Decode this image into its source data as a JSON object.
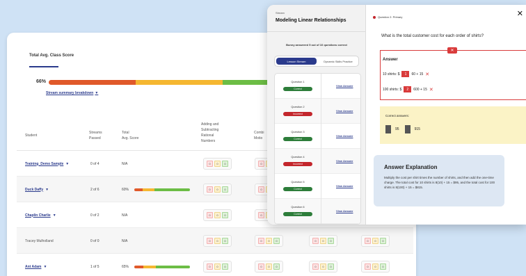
{
  "dashboard": {
    "total_avg_label": "Total Avg. Class Score",
    "total_avg_pct": "66%",
    "breakdown_link": "Stream summary breakdown",
    "bar_colors": [
      "#e0592a",
      "#f5b731",
      "#6cbd45"
    ],
    "bar_segments": [
      0.39,
      0.39,
      0.22
    ],
    "columns": {
      "student": "Student",
      "streams_passed": [
        "Streams",
        "Passed"
      ],
      "total_avg": [
        "Total",
        "Avg. Score"
      ],
      "adding": [
        "Adding and",
        "Subtracting",
        "Rational",
        "Numbers"
      ],
      "combining": [
        "Combi",
        "Motio"
      ]
    },
    "rows": [
      {
        "name": "Training_Demo Sample",
        "link": true,
        "passed": "0 of 4",
        "score": "N/A",
        "pct": null
      },
      {
        "name": "Duck Daffy",
        "link": true,
        "passed": "2 of 6",
        "score": "60%",
        "pct": 0.6
      },
      {
        "name": "Chaplin Charlie",
        "link": true,
        "passed": "0 of 2",
        "score": "N/A",
        "pct": null
      },
      {
        "name": "Tracey Mulholland",
        "link": false,
        "passed": "0 of 0",
        "score": "N/A",
        "pct": null
      },
      {
        "name": "Ant Adam",
        "link": true,
        "passed": "1 of 5",
        "score": "65%",
        "pct": 0.65
      }
    ],
    "box_values": [
      "0",
      "0",
      "0"
    ]
  },
  "modal": {
    "stream_label": "Stream",
    "stream_title": "Modeling Linear Relationships",
    "answered_text": "Bunny answered 5 out of 10 questions correct",
    "tab_lesson": "Lesson Stream",
    "tab_dynamic": "Dynamic Skills Practice",
    "questions": [
      {
        "label": "Question 1",
        "status": "Correct",
        "ok": true
      },
      {
        "label": "Question 2",
        "status": "Incorrect",
        "ok": false
      },
      {
        "label": "Question 3",
        "status": "Correct",
        "ok": true
      },
      {
        "label": "Question 4",
        "status": "Incorrect",
        "ok": false
      },
      {
        "label": "Question 5",
        "status": "Correct",
        "ok": true
      },
      {
        "label": "Question 6",
        "status": "Correct",
        "ok": true
      }
    ],
    "view_answer": "View Answer",
    "question_header": "Question 2: Primary",
    "question_text": "What is the total customer cost for each order of shirts?",
    "answer_title": "Answer",
    "answer_lines": [
      {
        "prefix": "10 shirts: $",
        "num": "1",
        "expr": "60 + 15"
      },
      {
        "prefix": "100 shirts: $",
        "num": "2",
        "expr": "600 + 15"
      }
    ],
    "correct_label": "Correct answers:",
    "correct_values": [
      "95",
      "915"
    ],
    "explanation_title": "Answer Explanation",
    "explanation_text": "Multiply the cost per shirt times the number of shirts, and then add the one-time charge. The total cost for 10 shirts is 8(10) + 15 = $95, and the total cost for 100 shirts is 8(100) + 15 = $815."
  }
}
